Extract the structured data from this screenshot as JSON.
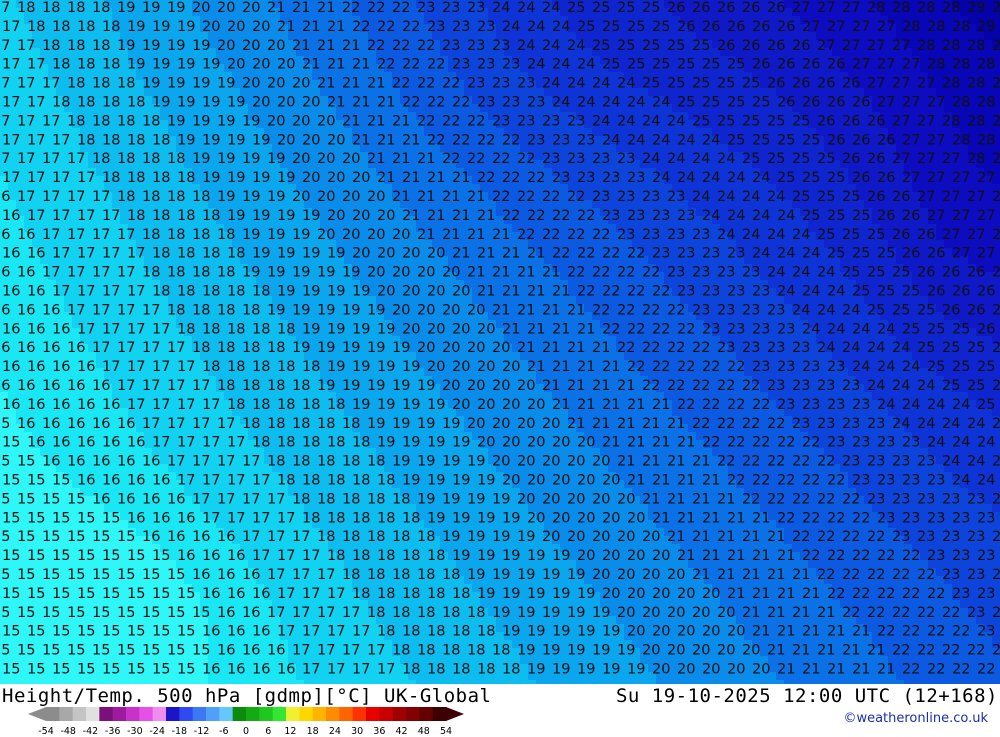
{
  "map": {
    "title": "Height/Temp. 500 hPa [gdmp][°C] UK-Global",
    "valid_time": "Su 19-10-2025 12:00 UTC (12+168)",
    "credit": "©weatheronline.co.uk",
    "contour_values": [
      "15",
      "16",
      "17",
      "18",
      "19",
      "20",
      "21",
      "22",
      "23",
      "24",
      "25",
      "26",
      "27",
      "28",
      "29"
    ],
    "colors": {
      "c15": "#2ff7f7",
      "c16": "#19e7f4",
      "c17": "#12d2f2",
      "c18": "#0dbdf0",
      "c19": "#0aa6ee",
      "c20": "#098cea",
      "c21": "#0a72e6",
      "c22": "#0c5ae2",
      "c23": "#0d45dc",
      "c24": "#0e33d6",
      "c25": "#0f25cf",
      "c26": "#1019c8",
      "c27": "#0d0cc0",
      "c28": "#0806b6",
      "c29": "#0402a8"
    }
  },
  "legend": {
    "ticks": [
      "-54",
      "-48",
      "-42",
      "-36",
      "-30",
      "-24",
      "-18",
      "-12",
      "-6",
      "0",
      "6",
      "12",
      "18",
      "24",
      "30",
      "36",
      "42",
      "48",
      "54"
    ],
    "colors": [
      "#8c8c8c",
      "#a8a8a8",
      "#c4c4c4",
      "#e0e0e0",
      "#7d0f7d",
      "#a01aa0",
      "#c832c8",
      "#e650e6",
      "#f08cf0",
      "#1c14c8",
      "#2d4bf0",
      "#3c78f5",
      "#50a0fa",
      "#64c8ff",
      "#0a8c0a",
      "#14aa14",
      "#1ec81e",
      "#32e632",
      "#f0f032",
      "#ffd700",
      "#ffb400",
      "#ff8c00",
      "#ff6400",
      "#ff3200",
      "#e60000",
      "#c80000",
      "#a00000",
      "#820000",
      "#640000",
      "#3c0000"
    ]
  }
}
